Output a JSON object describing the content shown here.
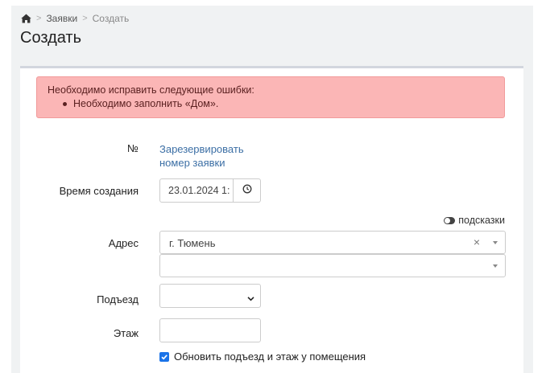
{
  "breadcrumb": {
    "home_icon": "home-icon",
    "separator": ">",
    "link": "Заявки",
    "current": "Создать"
  },
  "page_title": "Создать",
  "alert": {
    "heading": "Необходимо исправить следующие ошибки:",
    "errors": [
      "Необходимо заполнить «Дом»."
    ]
  },
  "form": {
    "number": {
      "label": "№",
      "link_line1": "Зарезервировать",
      "link_line2": "номер заявки"
    },
    "created_time": {
      "label": "Время создания",
      "value": "23.01.2024 1:",
      "icon": "clock-icon"
    },
    "hints_toggle": {
      "label": "подсказки",
      "icon": "toggle-icon"
    },
    "address": {
      "label": "Адрес",
      "city_value": "г. Тюмень",
      "clear_glyph": "×",
      "street_value": ""
    },
    "entrance": {
      "label": "Подъезд",
      "value": ""
    },
    "floor": {
      "label": "Этаж",
      "value": ""
    },
    "update_checkbox": {
      "label": "Обновить подъезд и этаж у помещения",
      "checked": true
    }
  },
  "colors": {
    "link": "#3c6fa5",
    "alert_bg": "#fbb6b6",
    "checkbox": "#1a73e8"
  }
}
